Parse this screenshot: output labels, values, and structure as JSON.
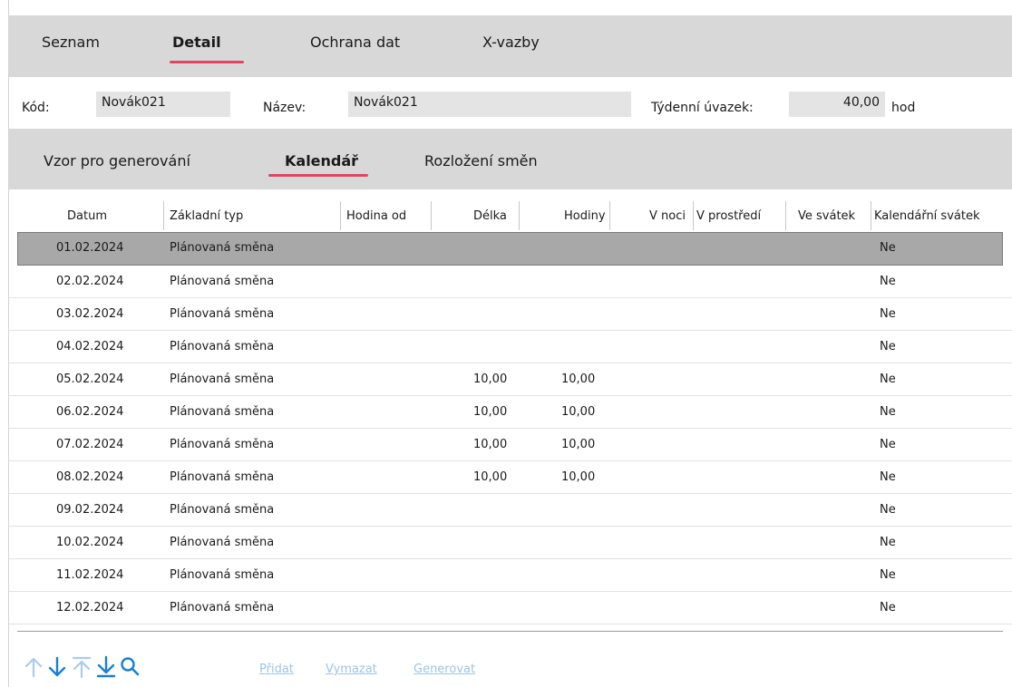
{
  "main_tabs": [
    {
      "label": "Seznam",
      "active": false
    },
    {
      "label": "Detail",
      "active": true
    },
    {
      "label": "Ochrana dat",
      "active": false
    },
    {
      "label": "X-vazby",
      "active": false
    }
  ],
  "fields": {
    "kod_label": "Kód:",
    "kod_value": "Novák021",
    "nazev_label": "Název:",
    "nazev_value": "Novák021",
    "uvazek_label": "Týdenní úvazek:",
    "uvazek_value": "40,00",
    "uvazek_unit": "hod"
  },
  "sub_tabs": [
    {
      "label": "Vzor pro generování",
      "active": false
    },
    {
      "label": "Kalendář",
      "active": true
    },
    {
      "label": "Rozložení směn",
      "active": false
    }
  ],
  "columns": [
    "Datum",
    "Základní typ",
    "Hodina od",
    "Délka",
    "Hodiny",
    "V noci",
    "V prostředí",
    "Ve svátek",
    "Kalendářní svátek"
  ],
  "rows": [
    {
      "datum": "01.02.2024",
      "typ": "Plánovaná směna",
      "od": "",
      "delka": "",
      "hodiny": "",
      "svatek": "Ne",
      "selected": true
    },
    {
      "datum": "02.02.2024",
      "typ": "Plánovaná směna",
      "od": "",
      "delka": "",
      "hodiny": "",
      "svatek": "Ne",
      "selected": false
    },
    {
      "datum": "03.02.2024",
      "typ": "Plánovaná směna",
      "od": "",
      "delka": "",
      "hodiny": "",
      "svatek": "Ne",
      "selected": false
    },
    {
      "datum": "04.02.2024",
      "typ": "Plánovaná směna",
      "od": "",
      "delka": "",
      "hodiny": "",
      "svatek": "Ne",
      "selected": false
    },
    {
      "datum": "05.02.2024",
      "typ": "Plánovaná směna",
      "od": "",
      "delka": "10,00",
      "hodiny": "10,00",
      "svatek": "Ne",
      "selected": false
    },
    {
      "datum": "06.02.2024",
      "typ": "Plánovaná směna",
      "od": "",
      "delka": "10,00",
      "hodiny": "10,00",
      "svatek": "Ne",
      "selected": false
    },
    {
      "datum": "07.02.2024",
      "typ": "Plánovaná směna",
      "od": "",
      "delka": "10,00",
      "hodiny": "10,00",
      "svatek": "Ne",
      "selected": false
    },
    {
      "datum": "08.02.2024",
      "typ": "Plánovaná směna",
      "od": "",
      "delka": "10,00",
      "hodiny": "10,00",
      "svatek": "Ne",
      "selected": false
    },
    {
      "datum": "09.02.2024",
      "typ": "Plánovaná směna",
      "od": "",
      "delka": "",
      "hodiny": "",
      "svatek": "Ne",
      "selected": false
    },
    {
      "datum": "10.02.2024",
      "typ": "Plánovaná směna",
      "od": "",
      "delka": "",
      "hodiny": "",
      "svatek": "Ne",
      "selected": false
    },
    {
      "datum": "11.02.2024",
      "typ": "Plánovaná směna",
      "od": "",
      "delka": "",
      "hodiny": "",
      "svatek": "Ne",
      "selected": false
    },
    {
      "datum": "12.02.2024",
      "typ": "Plánovaná směna",
      "od": "",
      "delka": "",
      "hodiny": "",
      "svatek": "Ne",
      "selected": false
    }
  ],
  "toolbar": {
    "icons": [
      "arrow-up-icon",
      "arrow-down-icon",
      "arrow-to-top-icon",
      "arrow-to-bottom-icon",
      "search-icon"
    ],
    "pridat": "Přidat",
    "vymazat": "Vymazat",
    "generovat": "Generovat"
  },
  "colors": {
    "accent": "#e0475e",
    "bar": "#d8d8d8",
    "selected_row": "#a8a8a8",
    "icon_active": "#1a7fd0",
    "icon_disabled": "#a9cdea",
    "link_disabled": "#9cc5e6"
  }
}
